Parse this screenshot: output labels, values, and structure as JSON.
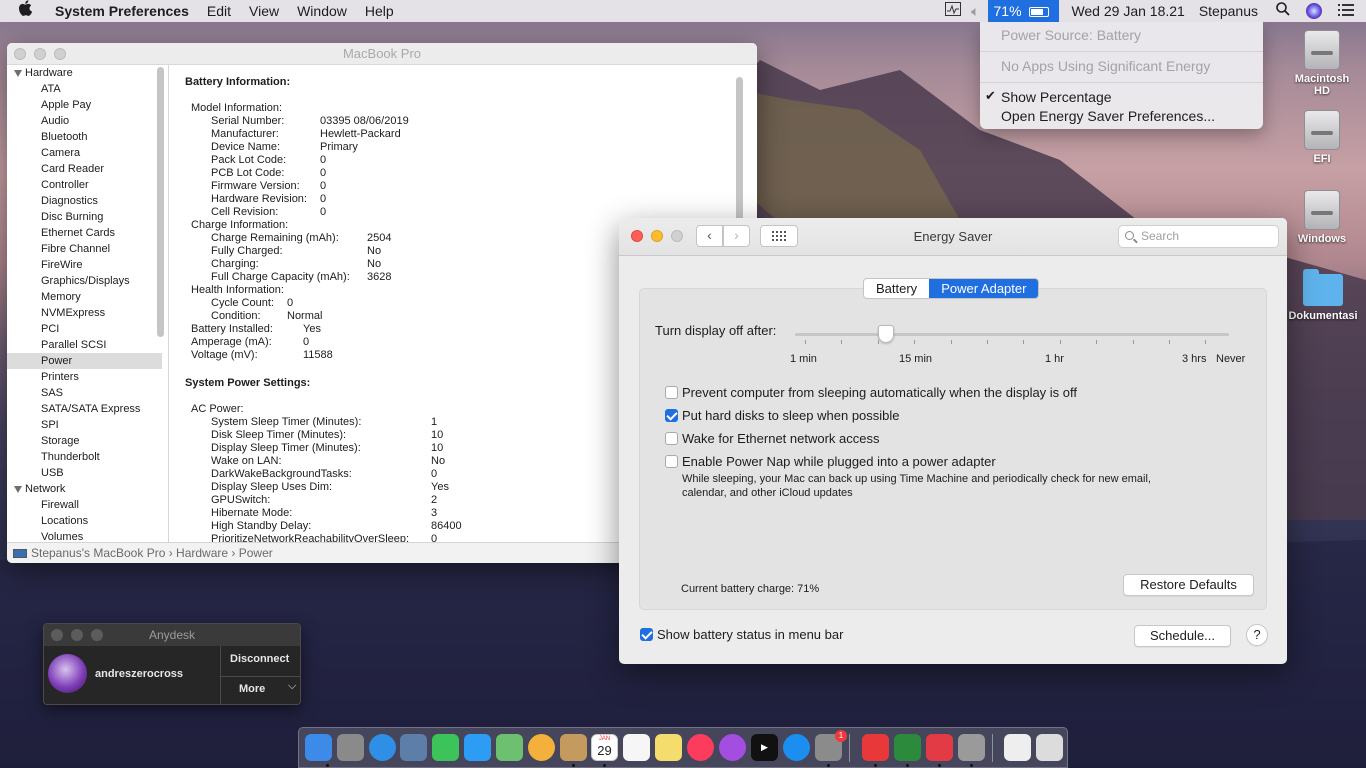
{
  "menubar": {
    "app_name": "System Preferences",
    "menus": [
      "Edit",
      "View",
      "Window",
      "Help"
    ],
    "battery_percent": "71%",
    "datetime": "Wed 29 Jan  18.21",
    "user": "Stepanus"
  },
  "battery_menu": {
    "power_source": "Power Source: Battery",
    "apps": "No Apps Using Significant Energy",
    "show_percentage": "Show Percentage",
    "show_percentage_checked": true,
    "open_prefs": "Open Energy Saver Preferences..."
  },
  "desktop": {
    "icons": [
      "Macintosh HD",
      "EFI",
      "Windows",
      "Dokumentasi"
    ]
  },
  "system_info": {
    "title": "MacBook Pro",
    "sidebar": {
      "hardware_label": "Hardware",
      "hardware_items": [
        "ATA",
        "Apple Pay",
        "Audio",
        "Bluetooth",
        "Camera",
        "Card Reader",
        "Controller",
        "Diagnostics",
        "Disc Burning",
        "Ethernet Cards",
        "Fibre Channel",
        "FireWire",
        "Graphics/Displays",
        "Memory",
        "NVMExpress",
        "PCI",
        "Parallel SCSI",
        "Power",
        "Printers",
        "SAS",
        "SATA/SATA Express",
        "SPI",
        "Storage",
        "Thunderbolt",
        "USB"
      ],
      "selected": "Power",
      "network_label": "Network",
      "network_items": [
        "Firewall",
        "Locations",
        "Volumes"
      ]
    },
    "battery_heading": "Battery Information:",
    "battery_lines": [
      {
        "k": "Model Information:",
        "v": "",
        "lvl": 0
      },
      {
        "k": "Serial Number:",
        "v": "03395 08/06/2019",
        "lvl": 1
      },
      {
        "k": "Manufacturer:",
        "v": "Hewlett-Packard",
        "lvl": 1
      },
      {
        "k": "Device Name:",
        "v": "Primary",
        "lvl": 1
      },
      {
        "k": "Pack Lot Code:",
        "v": "0",
        "lvl": 1
      },
      {
        "k": "PCB Lot Code:",
        "v": "0",
        "lvl": 1
      },
      {
        "k": "Firmware Version:",
        "v": "0",
        "lvl": 1
      },
      {
        "k": "Hardware Revision:",
        "v": "0",
        "lvl": 1
      },
      {
        "k": "Cell Revision:",
        "v": "0",
        "lvl": 1
      },
      {
        "k": "Charge Information:",
        "v": "",
        "lvl": 0
      },
      {
        "k": "Charge Remaining (mAh):",
        "v": "2504",
        "lvl": 2
      },
      {
        "k": "Fully Charged:",
        "v": "No",
        "lvl": 2
      },
      {
        "k": "Charging:",
        "v": "No",
        "lvl": 2
      },
      {
        "k": "Full Charge Capacity (mAh):",
        "v": "3628",
        "lvl": 2
      },
      {
        "k": "Health Information:",
        "v": "",
        "lvl": 0
      },
      {
        "k": "Cycle Count:",
        "v": "0",
        "lvl": 3
      },
      {
        "k": "Condition:",
        "v": "Normal",
        "lvl": 4
      },
      {
        "k": "Battery Installed:",
        "v": "Yes",
        "lvl": 5
      },
      {
        "k": "Amperage (mA):",
        "v": "0",
        "lvl": 5
      },
      {
        "k": "Voltage (mV):",
        "v": "11588",
        "lvl": 5
      }
    ],
    "power_heading": "System Power Settings:",
    "power_lines": [
      {
        "k": "AC Power:",
        "v": "",
        "lvl": 0
      },
      {
        "k": "System Sleep Timer (Minutes):",
        "v": "1",
        "lvl": 1
      },
      {
        "k": "Disk Sleep Timer (Minutes):",
        "v": "10",
        "lvl": 1
      },
      {
        "k": "Display Sleep Timer (Minutes):",
        "v": "10",
        "lvl": 1
      },
      {
        "k": "Wake on LAN:",
        "v": "No",
        "lvl": 1
      },
      {
        "k": "DarkWakeBackgroundTasks:",
        "v": "0",
        "lvl": 1
      },
      {
        "k": "Display Sleep Uses Dim:",
        "v": "Yes",
        "lvl": 1
      },
      {
        "k": "GPUSwitch:",
        "v": "2",
        "lvl": 1
      },
      {
        "k": "Hibernate Mode:",
        "v": "3",
        "lvl": 1
      },
      {
        "k": "High Standby Delay:",
        "v": "86400",
        "lvl": 1
      },
      {
        "k": "PrioritizeNetworkReachabilityOverSleep:",
        "v": "0",
        "lvl": 1
      }
    ],
    "path": [
      "Stepanus's MacBook Pro",
      "Hardware",
      "Power"
    ]
  },
  "energy_saver": {
    "title": "Energy Saver",
    "search_placeholder": "Search",
    "tabs": [
      "Battery",
      "Power Adapter"
    ],
    "active_tab": "Power Adapter",
    "slider_label": "Turn display off after:",
    "slider_ticks": [
      "1 min",
      "15 min",
      "1 hr",
      "3 hrs",
      "Never"
    ],
    "slider_value": "15 min",
    "options": [
      {
        "label": "Prevent computer from sleeping automatically when the display is off",
        "checked": false
      },
      {
        "label": "Put hard disks to sleep when possible",
        "checked": true
      },
      {
        "label": "Wake for Ethernet network access",
        "checked": false
      },
      {
        "label": "Enable Power Nap while plugged into a power adapter",
        "checked": false
      }
    ],
    "power_nap_desc_1": "While sleeping, your Mac can back up using Time Machine and periodically check for new email,",
    "power_nap_desc_2": "calendar, and other iCloud updates",
    "current_charge": "Current battery charge: 71%",
    "restore_defaults": "Restore Defaults",
    "show_status": "Show battery status in menu bar",
    "show_status_checked": true,
    "schedule": "Schedule...",
    "help": "?"
  },
  "anydesk": {
    "title": "Anydesk",
    "user": "andreszerocross",
    "disconnect": "Disconnect",
    "more": "More"
  },
  "dock": {
    "calendar_month": "JAN",
    "calendar_day": "29",
    "badge": "1",
    "apps": [
      "finder-icon",
      "launchpad-icon",
      "safari-icon",
      "preview-icon",
      "facetime-icon",
      "messages-icon",
      "maps-icon",
      "photos-icon",
      "notes-icon",
      "calendar-icon",
      "reminders-icon",
      "stickies-icon",
      "music-icon",
      "podcasts-icon",
      "tv-icon",
      "app-store-icon",
      "system-preferences-icon",
      "anydesk-icon",
      "kext-icon",
      "anydesk2-icon",
      "disk-utility-icon",
      "documents-icon",
      "trash-icon"
    ]
  }
}
